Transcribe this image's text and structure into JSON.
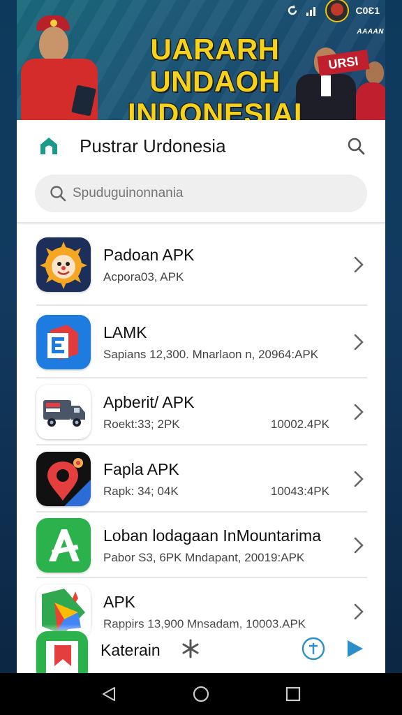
{
  "status_bar": {
    "icon_1": "refresh-icon",
    "icon_2": "signal-icon",
    "text": "C0Ɛ1"
  },
  "banner": {
    "title_line1": "UARARH UNDAOH",
    "title_line2": "INDONESIAI",
    "corner_text": "AAAAN",
    "tag_text": "URSI",
    "colors": {
      "title": "#f6d21a",
      "background": "#1e5a7a"
    }
  },
  "header": {
    "title": "Pustrar Urdonesia",
    "home_icon": "home-icon",
    "search_icon": "search-icon"
  },
  "search": {
    "placeholder": "Spuduguinonnania"
  },
  "apps": [
    {
      "name": "Padoan APK",
      "meta": "Acpora03, APK",
      "size": "",
      "icon": "sun-face-icon"
    },
    {
      "name": "LAMK",
      "meta": "Sapians 12,300. Mnarlaon n, 20964:APK",
      "size": "",
      "icon": "e-letter-icon"
    },
    {
      "name": "Apberit/ APK",
      "meta": "Roekt:33; 2PK",
      "size": "10002.4PK",
      "icon": "truck-icon"
    },
    {
      "name": "Fapla APK",
      "meta": "Rapk: 34; 04K",
      "size": "10043:4PK",
      "icon": "map-pin-icon"
    },
    {
      "name": "Loban lodagaan InMountarima",
      "meta": "Pabor S3, 6PK Mndapant, 20019:APK",
      "size": "",
      "icon": "a-letter-icon"
    },
    {
      "name": "APK",
      "meta": "Rappirs 13,900 Mnsadam, 10003.APK",
      "size": "",
      "icon": "navigation-icon"
    }
  ],
  "partial_app": {
    "name": "Katerain",
    "icon": "bookmark-icon"
  },
  "bottom_actions": {
    "asterisk": "asterisk-icon",
    "upload": "upload-circle-icon",
    "play": "play-icon"
  },
  "nav": {
    "back": "back-icon",
    "home": "home-circle-icon",
    "recent": "recent-apps-icon"
  }
}
